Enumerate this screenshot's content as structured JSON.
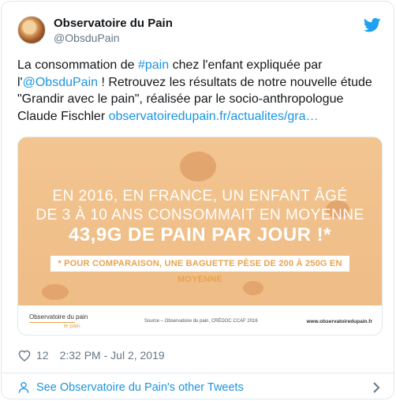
{
  "author": {
    "name": "Observatoire du Pain",
    "handle": "@ObsduPain"
  },
  "tweet": {
    "t1": "La consommation de ",
    "hashtag": "#pain",
    "t2": " chez l'enfant expliquée par",
    "t3": "l'",
    "mention": "@ObsduPain",
    "t4": " ! Retrouvez les résultats de notre nouvelle étude \"Grandir avec le pain\", réalisée par le socio-anthropologue Claude Fischler ",
    "link": "observatoiredupain.fr/actualites/gra…"
  },
  "image": {
    "line1": "EN 2016, EN FRANCE, UN ENFANT ÂGÉ",
    "line2": "DE 3 À 10 ANS CONSOMMAIT EN MOYENNE",
    "line3": "43,9G DE PAIN PAR JOUR !*",
    "note": "* POUR COMPARAISON, UNE BAGUETTE PÈSE DE 200 À 250G EN MOYENNE",
    "logo_line1": "Observatoire du pain",
    "logo_line2": "le pain",
    "source": "Source – Observatoire du pain, CRÉDOC CCAF 2016",
    "site": "www.observatoiredupain.fr"
  },
  "meta": {
    "likes": "12",
    "timestamp": "2:32 PM - Jul 2, 2019"
  },
  "footer": {
    "see_more": "See Observatoire du Pain's other Tweets"
  },
  "icons": {
    "bird": "twitter-bird-icon",
    "heart": "heart-icon",
    "person": "person-icon",
    "chevron": "chevron-right-icon"
  },
  "colors": {
    "link": "#1b95e0",
    "twitter_blue": "#1da1f2",
    "image_background": "#f0bf8a",
    "accent_orange": "#e8a34f"
  }
}
